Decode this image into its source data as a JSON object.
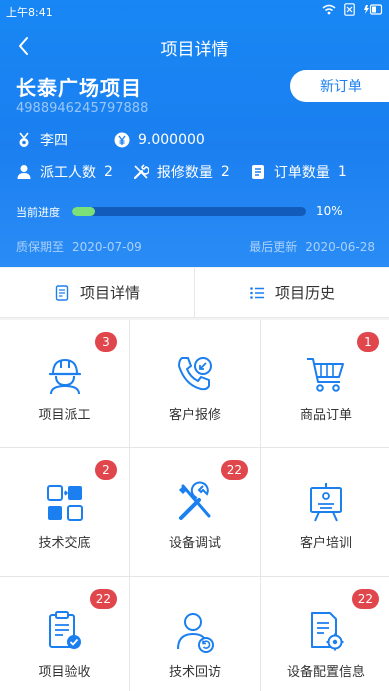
{
  "status": {
    "time": "上午8:41"
  },
  "nav": {
    "title": "项目详情"
  },
  "project": {
    "name": "长泰广场项目",
    "code": "4988946245797888",
    "new_order_label": "新订单",
    "manager": "李四",
    "amount": "9.000000",
    "workers_label": "派工人数",
    "workers_value": "2",
    "repairs_label": "报修数量",
    "repairs_value": "2",
    "orders_label": "订单数量",
    "orders_value": "1",
    "progress_label": "当前进度",
    "progress_value": "10%",
    "progress_fraction": 0.1,
    "warranty_label": "质保期至",
    "warranty_date": "2020-07-09",
    "updated_label": "最后更新",
    "updated_date": "2020-06-28"
  },
  "tabs": [
    {
      "label": "项目详情",
      "icon": "document-icon"
    },
    {
      "label": "项目历史",
      "icon": "list-icon"
    }
  ],
  "grid": [
    {
      "label": "项目派工",
      "badge": "3",
      "icon": "worker-helmet-icon"
    },
    {
      "label": "客户报修",
      "badge": "",
      "icon": "phone-call-icon"
    },
    {
      "label": "商品订单",
      "badge": "1",
      "icon": "shopping-cart-icon"
    },
    {
      "label": "技术交底",
      "badge": "2",
      "icon": "exchange-icon"
    },
    {
      "label": "设备调试",
      "badge": "22",
      "icon": "tools-icon"
    },
    {
      "label": "客户培训",
      "badge": "",
      "icon": "presentation-board-icon"
    },
    {
      "label": "项目验收",
      "badge": "22",
      "icon": "clipboard-check-icon"
    },
    {
      "label": "技术回访",
      "badge": "",
      "icon": "user-revisit-icon"
    },
    {
      "label": "设备配置信息",
      "badge": "22",
      "icon": "config-document-icon"
    }
  ],
  "colors": {
    "primary": "#1b7ff0",
    "badge": "#e0474c",
    "progress": "#7ce07a",
    "icon": "#1b7ff0"
  }
}
